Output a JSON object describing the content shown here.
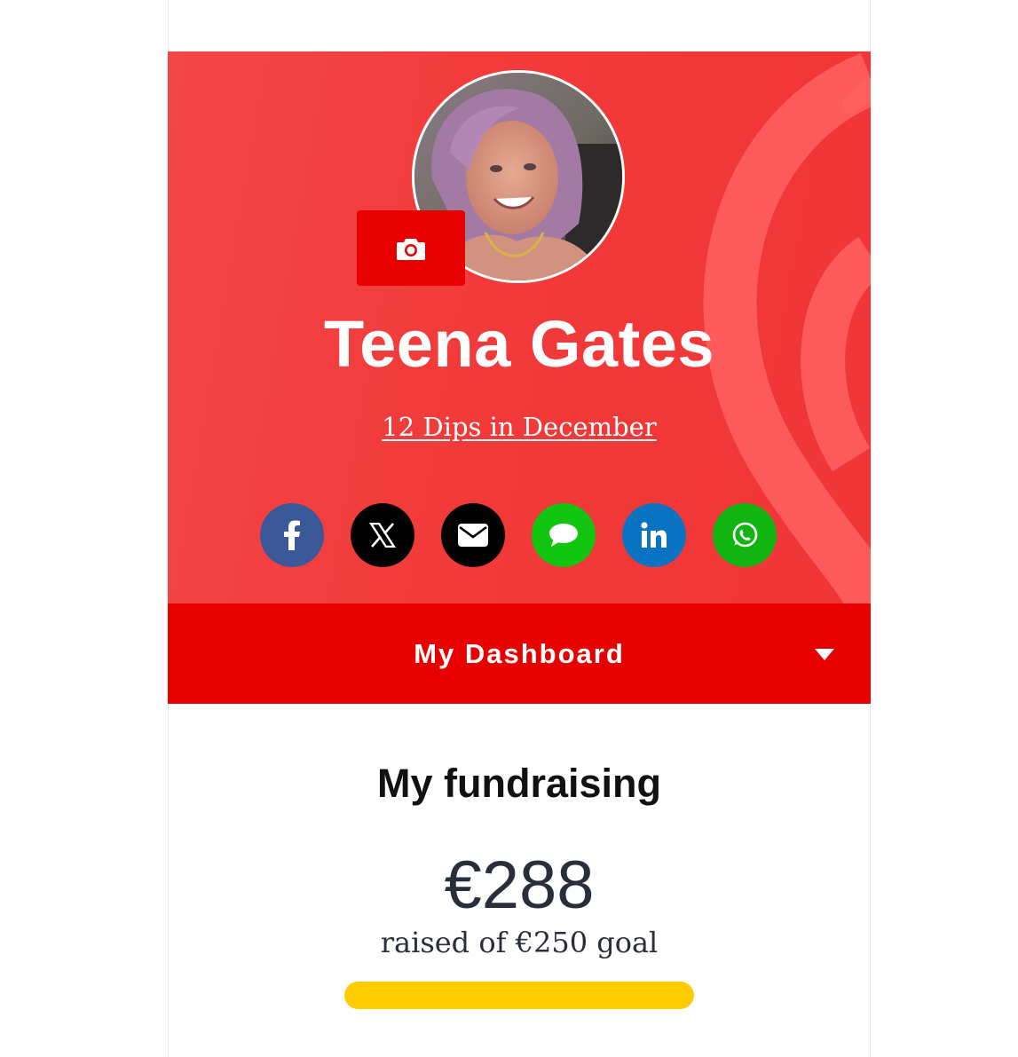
{
  "profile": {
    "name": "Teena Gates",
    "event_link": "12 Dips in December",
    "avatar_icon": "profile-photo",
    "camera_icon": "camera-icon"
  },
  "share": {
    "buttons": [
      {
        "name": "facebook",
        "icon": "facebook-icon",
        "color": "#3b5998"
      },
      {
        "name": "x",
        "icon": "x-icon",
        "color": "#000000"
      },
      {
        "name": "email",
        "icon": "envelope-icon",
        "color": "#000000"
      },
      {
        "name": "sms",
        "icon": "chat-bubble-icon",
        "color": "#11c511"
      },
      {
        "name": "linkedin",
        "icon": "linkedin-icon",
        "color": "#0a74c2"
      },
      {
        "name": "whatsapp",
        "icon": "whatsapp-icon",
        "color": "#11b411"
      }
    ]
  },
  "dashboard": {
    "label": "My Dashboard",
    "caret_icon": "caret-down-icon"
  },
  "fundraising": {
    "title": "My fundraising",
    "amount": "€288",
    "goal_text": "raised of €250 goal",
    "progress_fraction": 1.0
  },
  "colors": {
    "hero_bg": "#f23a3a",
    "brand_red": "#e60000",
    "progress": "#ffcc00",
    "text_dark": "#2a2e3a"
  }
}
